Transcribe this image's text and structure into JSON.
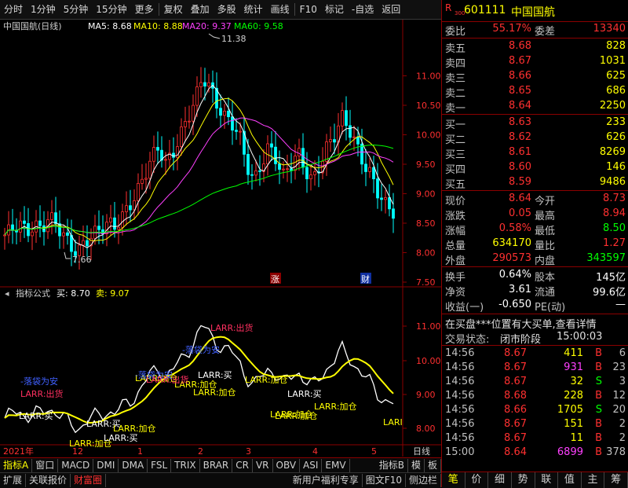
{
  "toolbar": {
    "items": [
      "分时",
      "1分钟",
      "5分钟",
      "15分钟",
      "更多",
      "复权",
      "叠加",
      "多股",
      "统计",
      "画线",
      "F10",
      "标记",
      "-自选",
      "返回"
    ]
  },
  "chart_header": {
    "stock": "中国国航(日线)",
    "ma5": "MA5: 8.68",
    "ma10": "MA10: 8.88",
    "ma20": "MA20: 9.37",
    "ma60": "MA60: 9.58"
  },
  "price_axis": [
    "11.00",
    "10.50",
    "10.00",
    "9.50",
    "9.00",
    "8.50",
    "8.00",
    "7.50"
  ],
  "annotations": {
    "high": "11.38",
    "low": "7.66",
    "mark1": "涨",
    "mark2": "财"
  },
  "indicator_header": {
    "name": "指标公式",
    "buy": "买: 8.70",
    "sell": "卖: 9.07"
  },
  "indicator_axis": [
    "11.00",
    "10.00",
    "9.00",
    "8.00"
  ],
  "signals": [
    {
      "text": "-落袋为安",
      "color": "#4060ff"
    },
    {
      "text": "LARR:出货",
      "color": "#ff3060"
    },
    {
      "text": "LARR:买",
      "color": "#ffffff"
    },
    {
      "text": "LARR:加仓",
      "color": "#ffff00"
    },
    {
      "text": "LARR:买",
      "color": "#ffffff"
    },
    {
      "text": "LARR:加仓",
      "color": "#ffff00"
    },
    {
      "text": "LARR:买",
      "color": "#ffffff"
    },
    {
      "text": "-落袋为安",
      "color": "#4060ff"
    },
    {
      "text": "LARR:出货",
      "color": "#ff3060"
    },
    {
      "text": "LARR:买",
      "color": "#ffffff"
    },
    {
      "text": "LARR:加仓",
      "color": "#ffff00"
    },
    {
      "text": "LARR:加仓",
      "color": "#ffff00"
    },
    {
      "text": "LARR:加仓",
      "color": "#ffff00"
    },
    {
      "text": "-落袋为安",
      "color": "#4060ff"
    },
    {
      "text": "LARR:出货",
      "color": "#ff3060"
    },
    {
      "text": "LARR:加仓",
      "color": "#ffff00"
    },
    {
      "text": "LARR:买",
      "color": "#ffffff"
    },
    {
      "text": "LARR:加仓",
      "color": "#ffff00"
    },
    {
      "text": "LARR:加仓",
      "color": "#ffff00"
    },
    {
      "text": "LARR:加仓",
      "color": "#ffff00"
    },
    {
      "text": "LARI",
      "color": "#ffff00"
    }
  ],
  "date_axis": {
    "year": "2021年",
    "m12": "12",
    "m1": "1",
    "m2": "2",
    "m3": "3",
    "m4": "4",
    "m5": "5",
    "period": "日线"
  },
  "bottom_tabs": [
    "指标A",
    "窗口",
    "MACD",
    "DMI",
    "DMA",
    "FSL",
    "TRIX",
    "BRAR",
    "CR",
    "VR",
    "OBV",
    "ASI",
    "EMV",
    "指标B",
    "模",
    "板"
  ],
  "bottom_tabs2": [
    "扩展",
    "关联报价",
    "财富圈",
    "新用户福利专享",
    "图文F10",
    "侧边栏"
  ],
  "quote": {
    "code": "601111",
    "name": "中国国航",
    "badge_top": "R",
    "badge_num": "300",
    "weibi_label": "委比",
    "weibi": "55.17%",
    "weicha_label": "委差",
    "weicha": "13340",
    "asks": [
      {
        "label": "卖五",
        "price": "8.68",
        "vol": "828"
      },
      {
        "label": "卖四",
        "price": "8.67",
        "vol": "1031"
      },
      {
        "label": "卖三",
        "price": "8.66",
        "vol": "625"
      },
      {
        "label": "卖二",
        "price": "8.65",
        "vol": "686"
      },
      {
        "label": "卖一",
        "price": "8.64",
        "vol": "2250"
      }
    ],
    "bids": [
      {
        "label": "买一",
        "price": "8.63",
        "vol": "233"
      },
      {
        "label": "买二",
        "price": "8.62",
        "vol": "626"
      },
      {
        "label": "买三",
        "price": "8.61",
        "vol": "8269"
      },
      {
        "label": "买四",
        "price": "8.60",
        "vol": "146"
      },
      {
        "label": "买五",
        "price": "8.59",
        "vol": "9486"
      }
    ],
    "stats": [
      {
        "l1": "现价",
        "v1": "8.64",
        "l2": "今开",
        "v2": "8.73"
      },
      {
        "l1": "涨跌",
        "v1": "0.05",
        "l2": "最高",
        "v2": "8.94"
      },
      {
        "l1": "涨幅",
        "v1": "0.58%",
        "l2": "最低",
        "v2": "8.50"
      },
      {
        "l1": "总量",
        "v1": "634170",
        "l2": "量比",
        "v2": "1.27"
      },
      {
        "l1": "外盘",
        "v1": "290573",
        "l2": "内盘",
        "v2": "343597"
      }
    ],
    "stats2": [
      {
        "l1": "换手",
        "v1": "0.64%",
        "l2": "股本",
        "v2": "145亿"
      },
      {
        "l1": "净资",
        "v1": "3.61",
        "l2": "流通",
        "v2": "99.6亿"
      },
      {
        "l1": "收益(一)",
        "v1": "-0.650",
        "l2": "PE(动)",
        "v2": "—"
      }
    ],
    "notice": "在买盘***位置有大买单,查看详情",
    "status_label": "交易状态:",
    "status": "闭市阶段",
    "status_time": "15:00:03",
    "ticks": [
      {
        "t": "14:56",
        "p": "8.67",
        "v": "411",
        "s": "B",
        "n": "6"
      },
      {
        "t": "14:56",
        "p": "8.67",
        "v": "931",
        "s": "B",
        "n": "23"
      },
      {
        "t": "14:56",
        "p": "8.67",
        "v": "32",
        "s": "S",
        "n": "3"
      },
      {
        "t": "14:56",
        "p": "8.68",
        "v": "228",
        "s": "B",
        "n": "12"
      },
      {
        "t": "14:56",
        "p": "8.66",
        "v": "1705",
        "s": "S",
        "n": "20"
      },
      {
        "t": "14:56",
        "p": "8.67",
        "v": "151",
        "s": "B",
        "n": "2"
      },
      {
        "t": "14:56",
        "p": "8.67",
        "v": "11",
        "s": "B",
        "n": "2"
      },
      {
        "t": "15:00",
        "p": "8.64",
        "v": "6899",
        "s": "B",
        "n": "378"
      }
    ],
    "right_tabs": [
      "笔",
      "价",
      "细",
      "势",
      "联",
      "值",
      "主",
      "筹"
    ]
  }
}
